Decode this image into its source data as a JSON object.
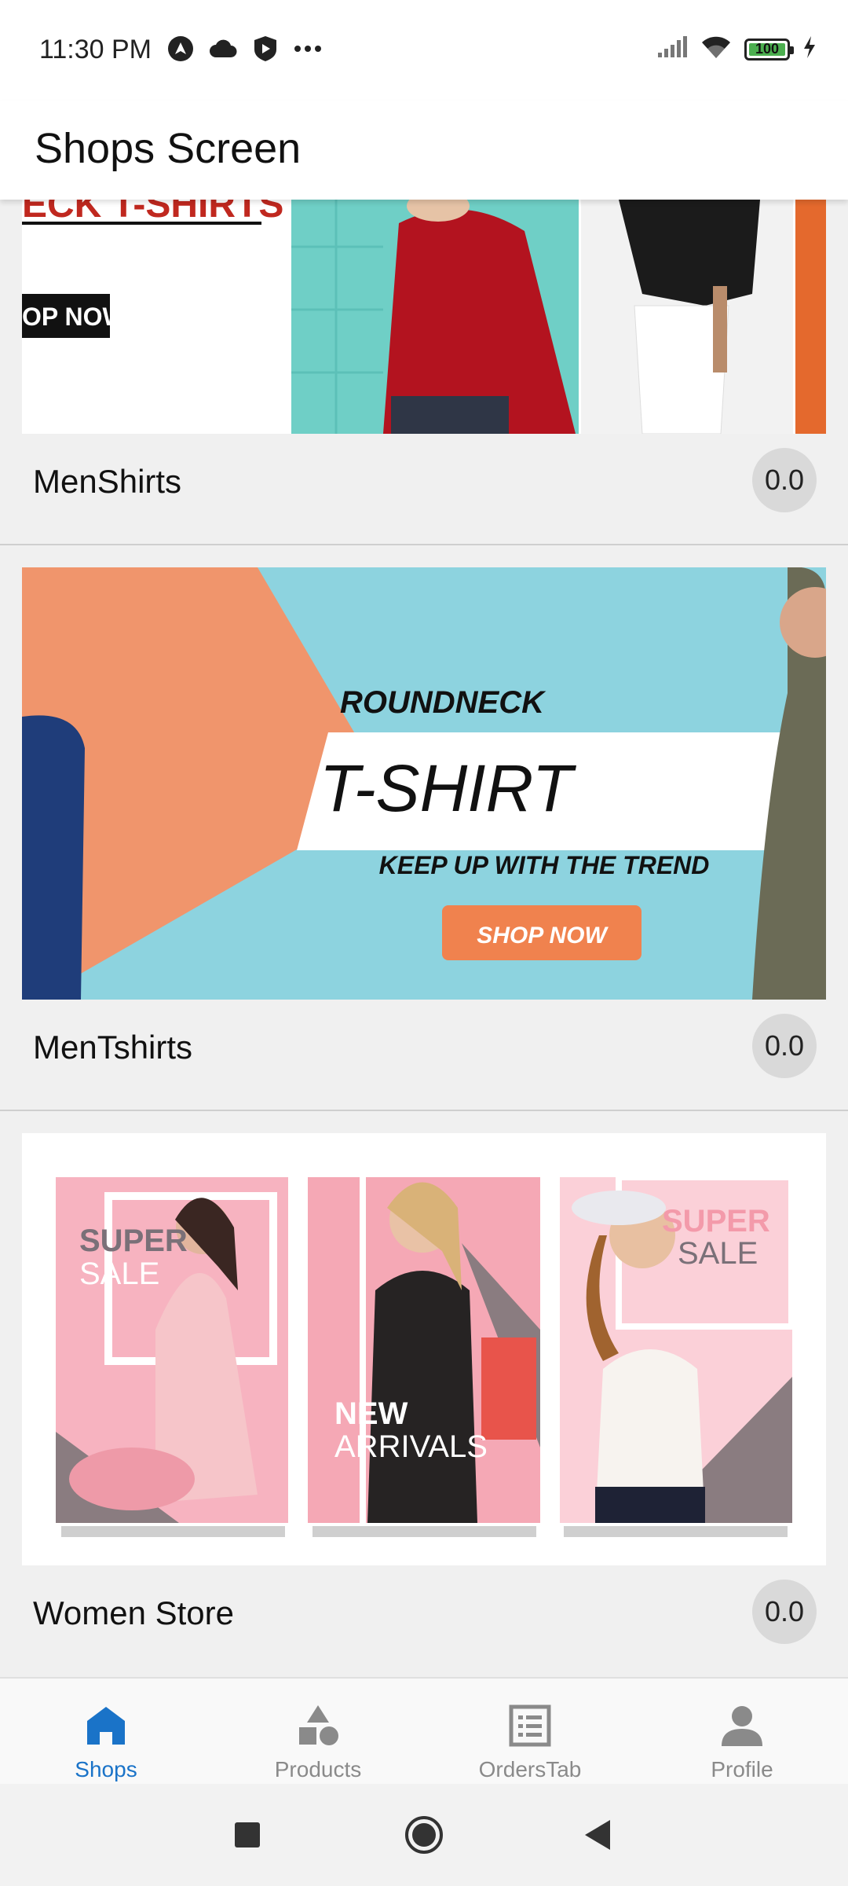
{
  "status": {
    "time": "11:30 PM",
    "battery": "100",
    "left_icons": [
      "android-auto-icon",
      "cloud-icon",
      "shield-play-icon",
      "more-dots-icon"
    ],
    "right_icons": [
      "signal-icon",
      "wifi-icon",
      "battery-icon",
      "charging-bolt-icon"
    ]
  },
  "appbar": {
    "title": "Shops Screen"
  },
  "shops": [
    {
      "name": "MenShirts",
      "rating": "0.0",
      "banner": {
        "heading_fragment": "ECK T-SHIRTS",
        "button_fragment": "OP NOW"
      }
    },
    {
      "name": "MenTshirts",
      "rating": "0.0",
      "banner": {
        "line1": "ROUNDNECK",
        "line2": "T-SHIRT",
        "line3": "KEEP UP WITH THE TREND",
        "button": "SHOP NOW"
      }
    },
    {
      "name": "Women Store",
      "rating": "0.0",
      "banner": {
        "poster1_line1": "SUPER",
        "poster1_line2": "SALE",
        "poster2_line1": "NEW",
        "poster2_line2": "ARRIVALS",
        "poster3_line1": "SUPER",
        "poster3_line2": "SALE"
      }
    }
  ],
  "bottom_nav": [
    {
      "label": "Shops",
      "icon": "home-icon",
      "active": true
    },
    {
      "label": "Products",
      "icon": "shapes-icon",
      "active": false
    },
    {
      "label": "OrdersTab",
      "icon": "list-icon",
      "active": false
    },
    {
      "label": "Profile",
      "icon": "person-icon",
      "active": false
    }
  ],
  "colors": {
    "accent": "#1a73c8",
    "inactive": "#8a8a8a",
    "banner_teal": "#8dd3df",
    "banner_orange": "#f0956c",
    "sale_pink": "#f7b3c0"
  },
  "system_nav": [
    "recents-button",
    "home-button",
    "back-button"
  ]
}
